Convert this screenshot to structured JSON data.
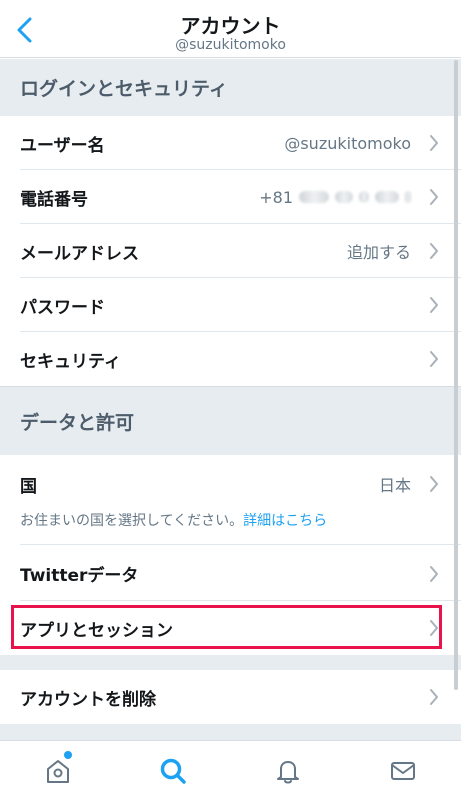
{
  "header": {
    "title": "アカウント",
    "username": "@suzukitomoko"
  },
  "sections": {
    "login_security": "ログインとセキュリティ",
    "data_permissions": "データと許可"
  },
  "rows": {
    "username": {
      "label": "ユーザー名",
      "value": "@suzukitomoko"
    },
    "phone": {
      "label": "電話番号",
      "value": "+81"
    },
    "email": {
      "label": "メールアドレス",
      "value": "追加する"
    },
    "password": {
      "label": "パスワード"
    },
    "security": {
      "label": "セキュリティ"
    },
    "country": {
      "label": "国",
      "value": "日本",
      "note": "お住まいの国を選択してください。",
      "link": "詳細はこちら"
    },
    "twitter_data": {
      "label": "Twitterデータ"
    },
    "apps_sessions": {
      "label": "アプリとセッション"
    },
    "delete_account": {
      "label": "アカウントを削除"
    }
  },
  "tabs": [
    "home-icon",
    "search-icon",
    "notifications-icon",
    "messages-icon"
  ],
  "colors": {
    "accent": "#1da1f2",
    "highlight": "#e8134b",
    "section_bg": "#e6ecf0"
  }
}
